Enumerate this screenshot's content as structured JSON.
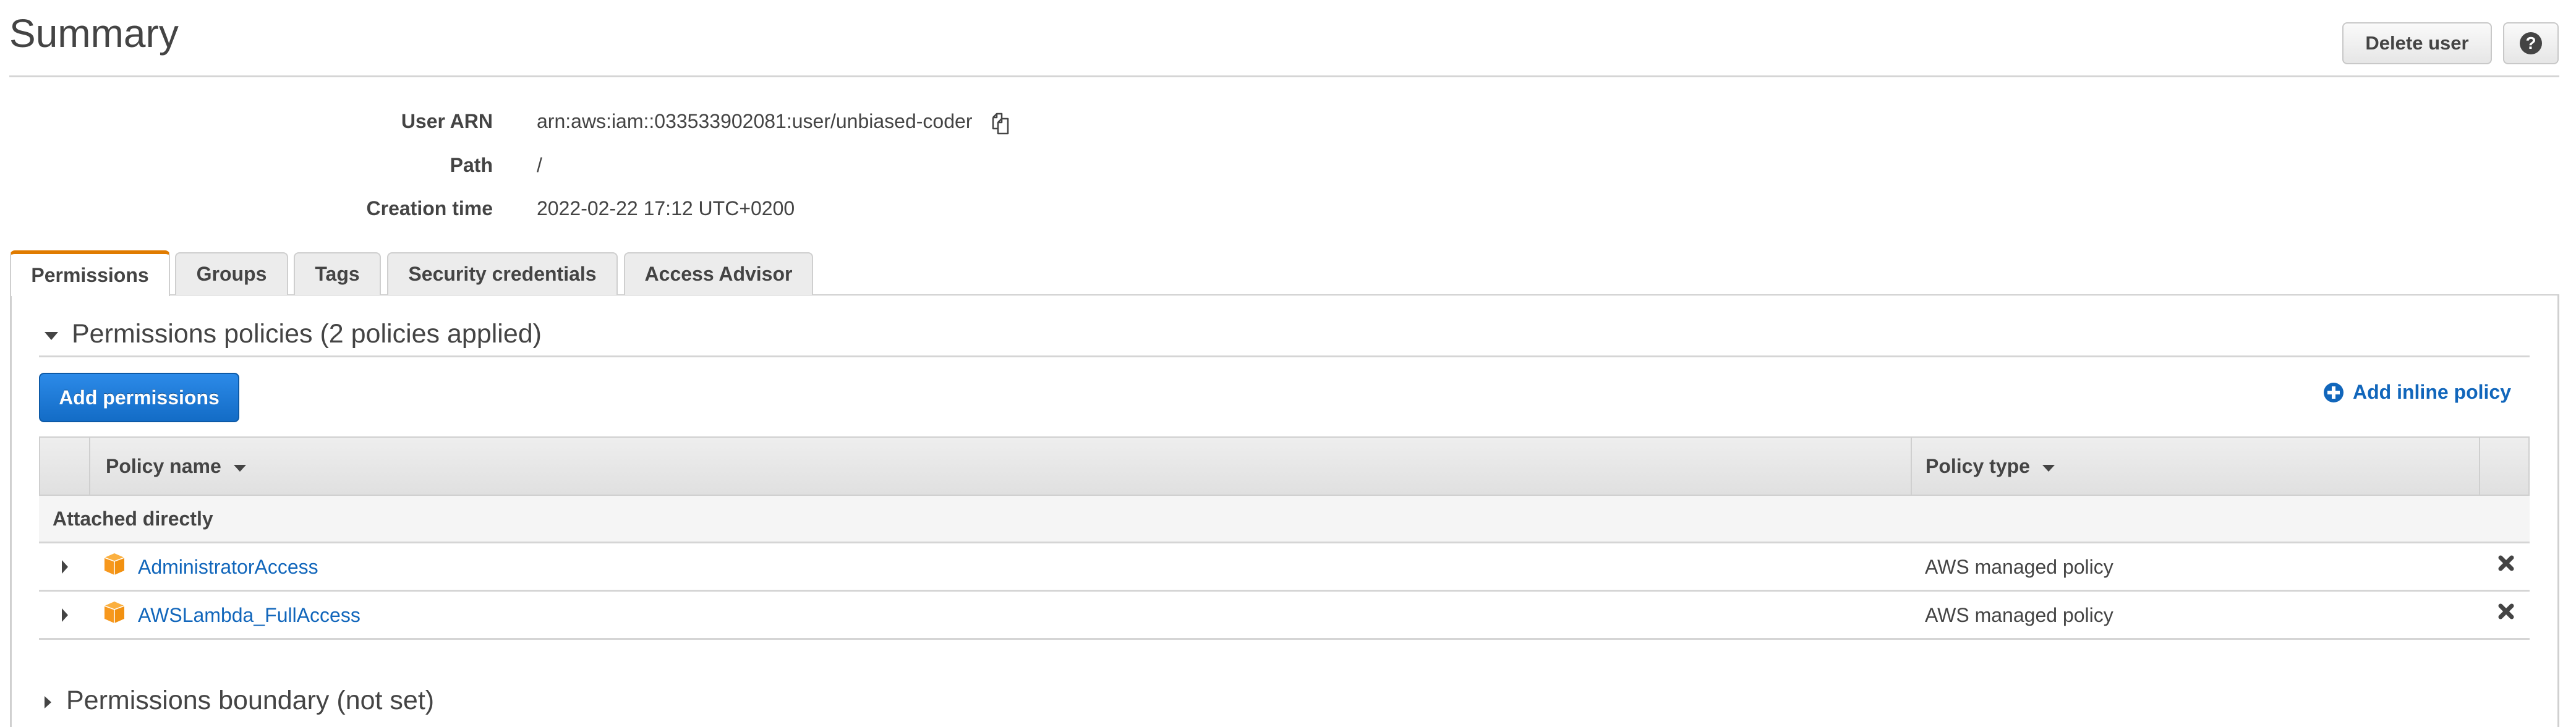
{
  "header": {
    "title": "Summary",
    "delete_user_label": "Delete user",
    "help_icon": "question-circle-icon"
  },
  "summary": {
    "user_arn_label": "User ARN",
    "user_arn_value": "arn:aws:iam::033533902081:user/unbiased-coder",
    "copy_icon": "copy-icon",
    "path_label": "Path",
    "path_value": "/",
    "creation_time_label": "Creation time",
    "creation_time_value": "2022-02-22 17:12 UTC+0200"
  },
  "tabs": [
    {
      "label": "Permissions",
      "active": true
    },
    {
      "label": "Groups",
      "active": false
    },
    {
      "label": "Tags",
      "active": false
    },
    {
      "label": "Security credentials",
      "active": false
    },
    {
      "label": "Access Advisor",
      "active": false
    }
  ],
  "permissions": {
    "policies_section_title": "Permissions policies (2 policies applied)",
    "add_permissions_label": "Add permissions",
    "add_inline_policy_label": "Add inline policy",
    "table": {
      "columns": [
        "Policy name",
        "Policy type"
      ],
      "group_label": "Attached directly",
      "rows": [
        {
          "name": "AdministratorAccess",
          "type": "AWS managed policy",
          "icon": "aws-managed-policy-cube-icon"
        },
        {
          "name": "AWSLambda_FullAccess",
          "type": "AWS managed policy",
          "icon": "aws-managed-policy-cube-icon"
        }
      ]
    },
    "boundary_section_title": "Permissions boundary (not set)"
  },
  "colors": {
    "accent_tab": "#e07b00",
    "primary_button": "#1f7ad6",
    "link": "#1166bb",
    "policy_icon": "#f7981d"
  }
}
